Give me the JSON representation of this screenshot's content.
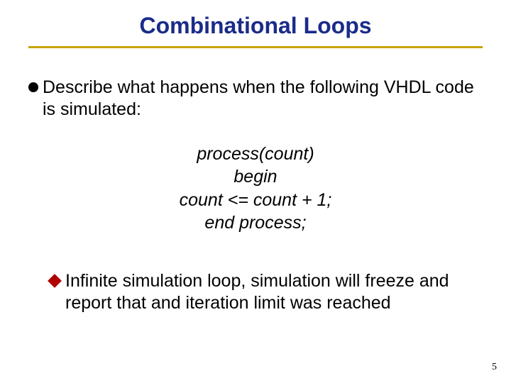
{
  "title": "Combinational Loops",
  "bullet1": "Describe what happens when the following VHDL code is simulated:",
  "code": {
    "line1": "process(count)",
    "line2": "begin",
    "line3": "count <= count + 1;",
    "line4": "end process;"
  },
  "sub_bullet": "Infinite simulation loop, simulation will freeze and report that and iteration limit was reached",
  "page_number": "5"
}
